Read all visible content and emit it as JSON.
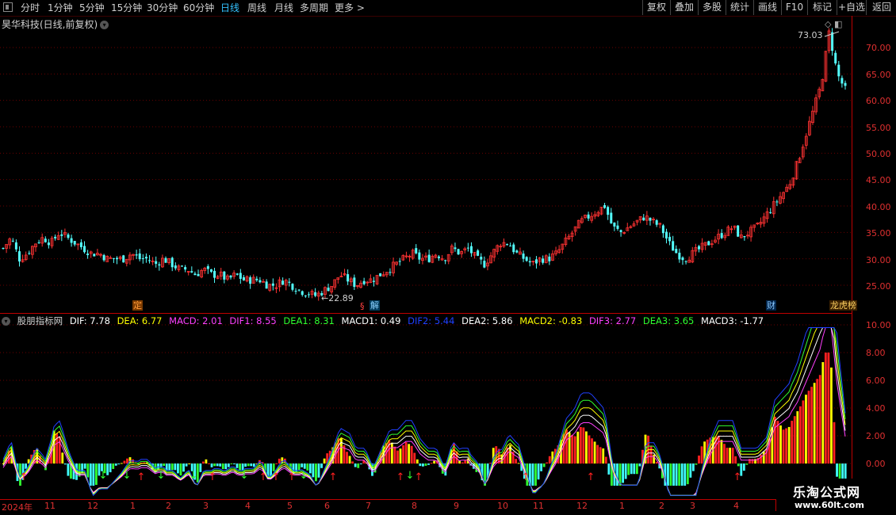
{
  "toolbar": {
    "periods": [
      "分时",
      "1分钟",
      "5分钟",
      "15分钟",
      "30分钟",
      "60分钟",
      "日线",
      "周线",
      "月线",
      "多周期",
      "更多 >"
    ],
    "active_period": "日线",
    "right_buttons": [
      "复权",
      "叠加",
      "多股",
      "统计",
      "画线",
      "F10",
      "+自选",
      "返回"
    ],
    "right_extra": "标记"
  },
  "stock": {
    "title": "昊华科技(日线,前复权)"
  },
  "price_chart": {
    "max_label": "73.03",
    "min_label": "22.89",
    "axis_labels": [
      "70.00",
      "65.00",
      "60.00",
      "55.00",
      "50.00",
      "45.00",
      "40.00",
      "35.00",
      "30.00",
      "25.00"
    ],
    "events": {
      "ding": "定",
      "jie": "解",
      "cai": "财",
      "zhang": "龙虎榜"
    }
  },
  "indicator": {
    "name": "股朋指标网",
    "values": [
      {
        "label": "DIF: 7.78",
        "color": "#ffffff"
      },
      {
        "label": "DEA: 6.77",
        "color": "#ffff00"
      },
      {
        "label": "MACD: 2.01",
        "color": "#ff40ff"
      },
      {
        "label": "DIF1: 8.55",
        "color": "#ff40ff"
      },
      {
        "label": "DEA1: 8.31",
        "color": "#30ff30"
      },
      {
        "label": "MACD1: 0.49",
        "color": "#ffffff"
      },
      {
        "label": "DIF2: 5.44",
        "color": "#2040ff"
      },
      {
        "label": "DEA2: 5.86",
        "color": "#ffffff"
      },
      {
        "label": "MACD2: -0.83",
        "color": "#ffff00"
      },
      {
        "label": "DIF3: 2.77",
        "color": "#ff40ff"
      },
      {
        "label": "DEA3: 3.65",
        "color": "#30ff30"
      },
      {
        "label": "MACD3: -1.77",
        "color": "#ffffff"
      }
    ],
    "axis_labels": [
      "10.00",
      "8.00",
      "6.00",
      "4.00",
      "2.00",
      "0.00"
    ]
  },
  "date_axis": [
    "2024年",
    "11",
    "12",
    "1",
    "2",
    "3",
    "4",
    "5",
    "6",
    "7",
    "8",
    "9",
    "10",
    "11",
    "12",
    "1",
    "2",
    "3",
    "4"
  ],
  "watermark": {
    "line1": "乐淘公式网",
    "line2": "www.60lt.com"
  },
  "chart_data": {
    "type": "candlestick",
    "title": "昊华科技(日线,前复权)",
    "price_range": [
      22.89,
      73.03
    ],
    "ylim": [
      23,
      73
    ],
    "close_series": [
      32,
      34,
      30,
      31,
      33,
      34,
      33,
      35,
      34,
      33,
      32,
      31,
      31,
      30,
      30,
      30,
      31,
      30,
      30,
      29,
      30,
      29,
      28,
      28,
      27,
      28,
      27,
      27,
      26,
      27,
      26,
      26,
      26,
      25,
      25,
      26,
      25,
      24,
      23.5,
      23,
      24,
      25,
      27,
      26,
      25,
      26,
      26,
      27,
      28,
      29,
      30,
      31,
      30,
      30,
      31,
      30,
      32,
      31,
      32,
      30,
      29,
      31,
      33,
      33,
      31,
      30,
      29,
      30,
      30,
      31,
      33,
      35,
      37,
      38,
      39,
      40,
      36,
      35,
      36,
      37,
      38,
      37,
      36,
      33,
      31,
      30,
      31,
      32,
      33,
      34,
      35,
      36,
      34,
      35,
      36,
      38,
      40,
      42,
      44,
      48,
      53,
      58,
      63,
      73,
      65,
      62
    ],
    "indicator_range": [
      -3.0,
      10.0
    ]
  }
}
